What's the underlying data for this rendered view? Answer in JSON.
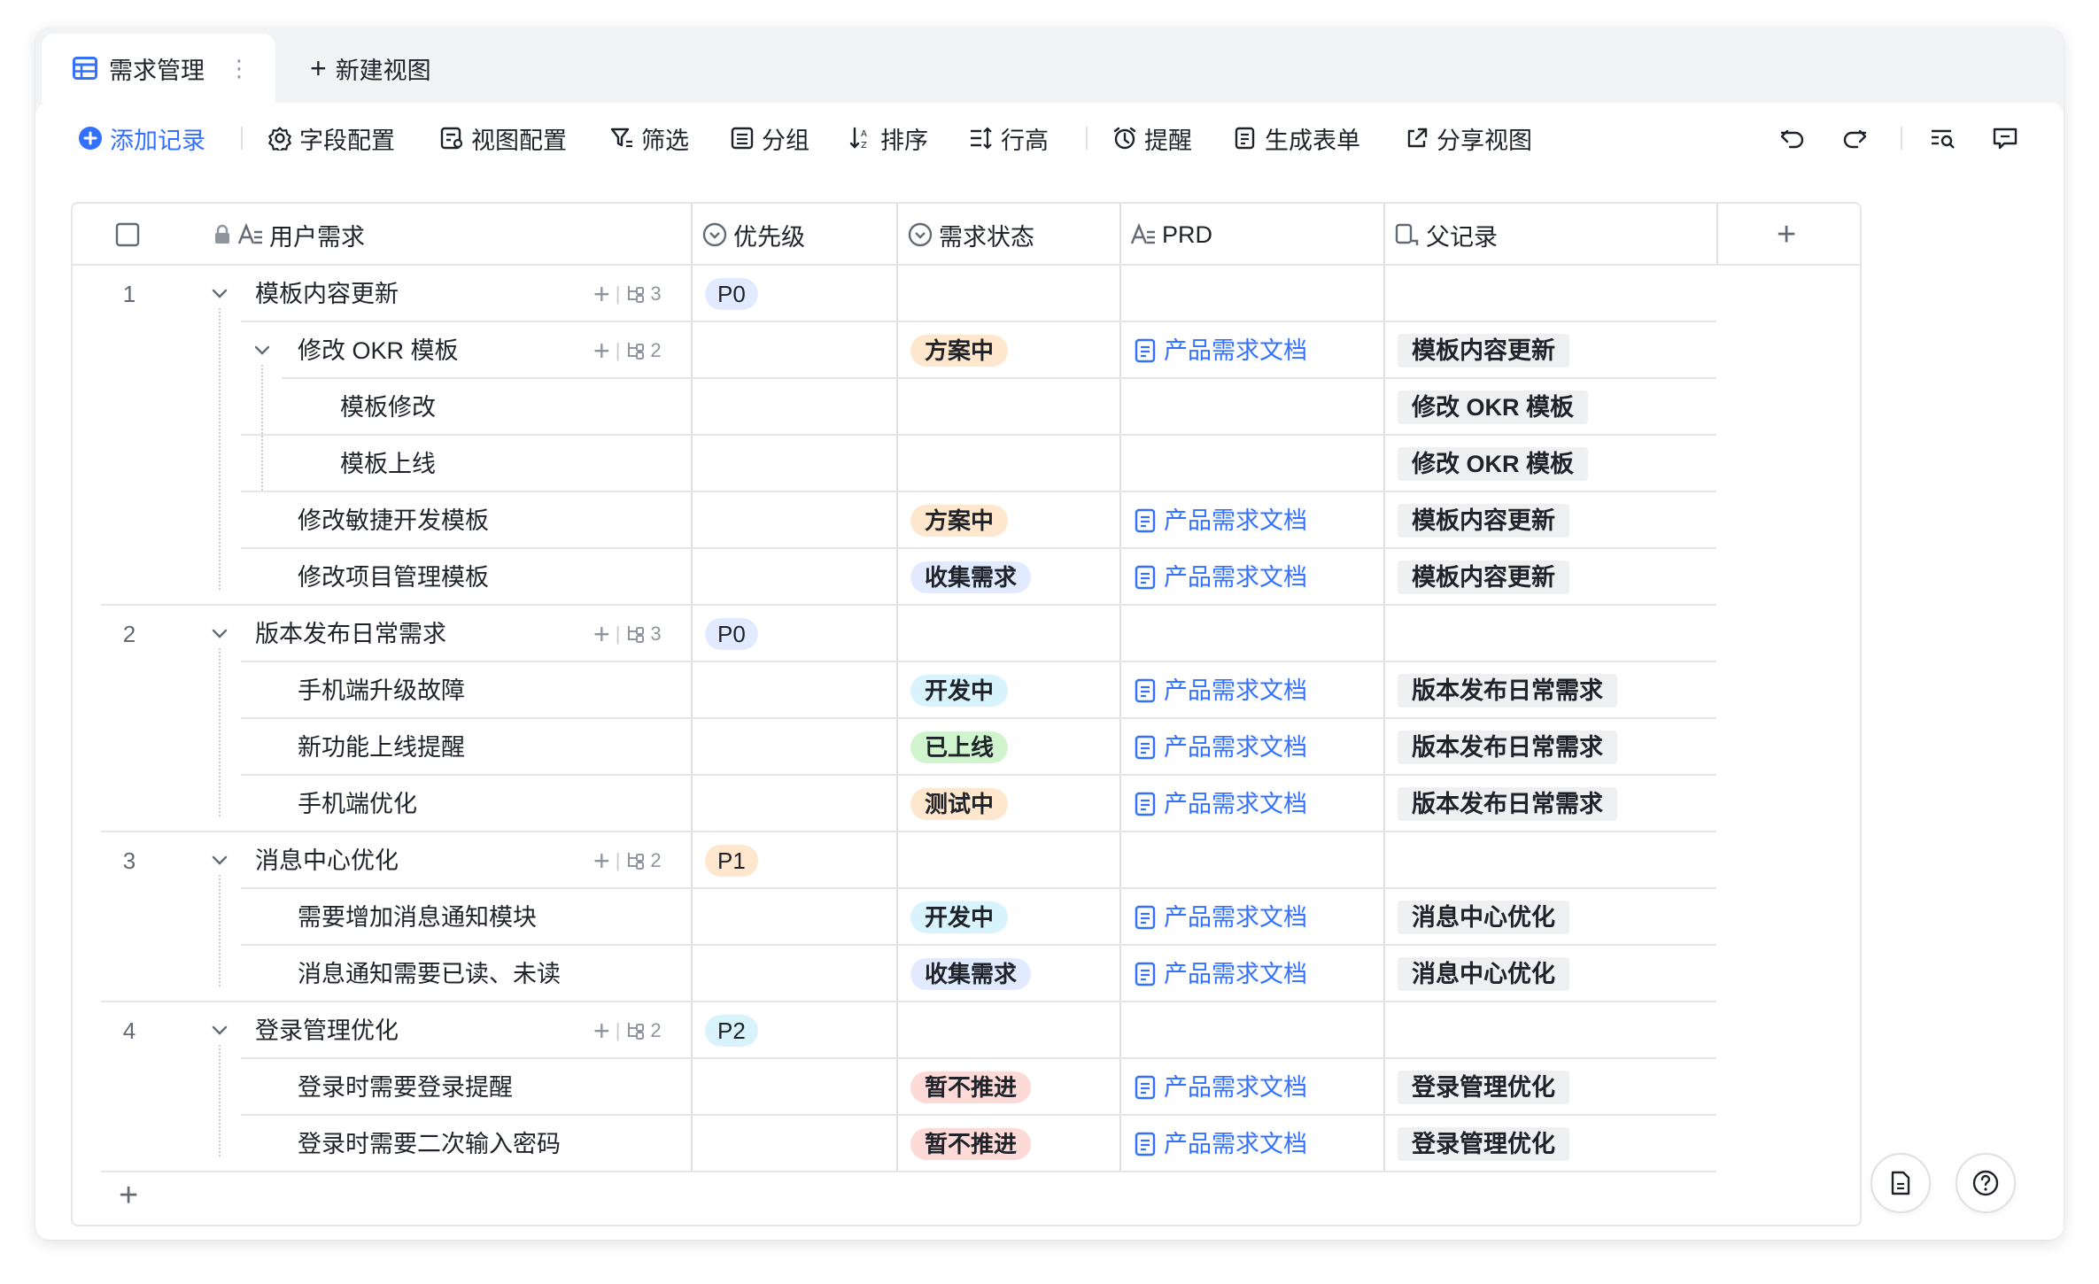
{
  "tabs": {
    "active_label": "需求管理",
    "new_view_label": "新建视图"
  },
  "toolbar": {
    "add_record": "添加记录",
    "field_config": "字段配置",
    "view_config": "视图配置",
    "filter": "筛选",
    "group": "分组",
    "sort": "排序",
    "row_height": "行高",
    "reminder": "提醒",
    "generate_form": "生成表单",
    "share_view": "分享视图"
  },
  "columns": {
    "user_need": "用户需求",
    "priority": "优先级",
    "status": "需求状态",
    "prd": "PRD",
    "parent": "父记录"
  },
  "colors": {
    "accent": "#3370ff",
    "p0": "#e1eaff",
    "p1": "#fee7cd",
    "p2": "#d9f3fd",
    "planning": "#fee7cd",
    "collecting": "#e1eaff",
    "developing": "#d9f3fd",
    "released": "#d0f5ce",
    "testing": "#fee7cd",
    "paused": "#fdd9d8"
  },
  "rows": [
    {
      "num": "1",
      "name": "模板内容更新",
      "priority": "P0",
      "children_count": "3"
    },
    {
      "name": "修改 OKR 模板",
      "status": "方案中",
      "prd": "产品需求文档",
      "parent": "模板内容更新",
      "children_count": "2"
    },
    {
      "name": "模板修改",
      "parent": "修改 OKR 模板"
    },
    {
      "name": "模板上线",
      "parent": "修改 OKR 模板"
    },
    {
      "name": "修改敏捷开发模板",
      "status": "方案中",
      "prd": "产品需求文档",
      "parent": "模板内容更新"
    },
    {
      "name": "修改项目管理模板",
      "status": "收集需求",
      "prd": "产品需求文档",
      "parent": "模板内容更新"
    },
    {
      "num": "2",
      "name": "版本发布日常需求",
      "priority": "P0",
      "children_count": "3"
    },
    {
      "name": "手机端升级故障",
      "status": "开发中",
      "prd": "产品需求文档",
      "parent": "版本发布日常需求"
    },
    {
      "name": "新功能上线提醒",
      "status": "已上线",
      "prd": "产品需求文档",
      "parent": "版本发布日常需求"
    },
    {
      "name": "手机端优化",
      "status": "测试中",
      "prd": "产品需求文档",
      "parent": "版本发布日常需求"
    },
    {
      "num": "3",
      "name": "消息中心优化",
      "priority": "P1",
      "children_count": "2"
    },
    {
      "name": "需要增加消息通知模块",
      "status": "开发中",
      "prd": "产品需求文档",
      "parent": "消息中心优化"
    },
    {
      "name": "消息通知需要已读、未读",
      "status": "收集需求",
      "prd": "产品需求文档",
      "parent": "消息中心优化"
    },
    {
      "num": "4",
      "name": "登录管理优化",
      "priority": "P2",
      "children_count": "2"
    },
    {
      "name": "登录时需要登录提醒",
      "status": "暂不推进",
      "prd": "产品需求文档",
      "parent": "登录管理优化"
    },
    {
      "name": "登录时需要二次输入密码",
      "status": "暂不推进",
      "prd": "产品需求文档",
      "parent": "登录管理优化"
    }
  ]
}
